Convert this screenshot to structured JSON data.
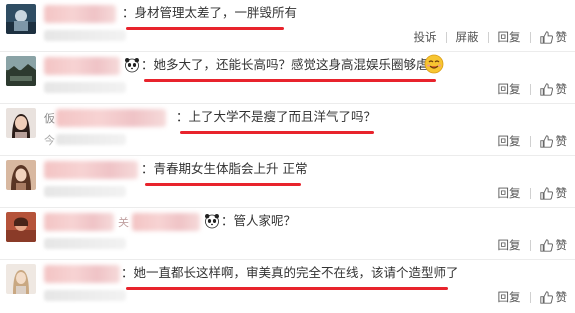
{
  "actions": {
    "report": "投诉",
    "block": "屏蔽",
    "reply": "回复",
    "like": "赞"
  },
  "colors": {
    "underline": "#e8232c",
    "text": "#333333",
    "action": "#555555"
  },
  "comments": [
    {
      "text": "：身材管理太差了，一胖毁所有",
      "extra_actions": true
    },
    {
      "text": "：她多大了，还能长高吗？感觉这身高混娱乐圈够虐的",
      "emoji": "smiling-face-icon"
    },
    {
      "name_prefix": "仮",
      "time_prefix": "今",
      "text": "：上了大学不是瘦了而且洋气了吗？"
    },
    {
      "text": "：青春期女生体脂会上升 正常"
    },
    {
      "name_suffix": "关",
      "text": "：管人家呢？"
    },
    {
      "text": "：她一直都长这样啊，审美真的完全不在线，该请个造型师了"
    }
  ]
}
